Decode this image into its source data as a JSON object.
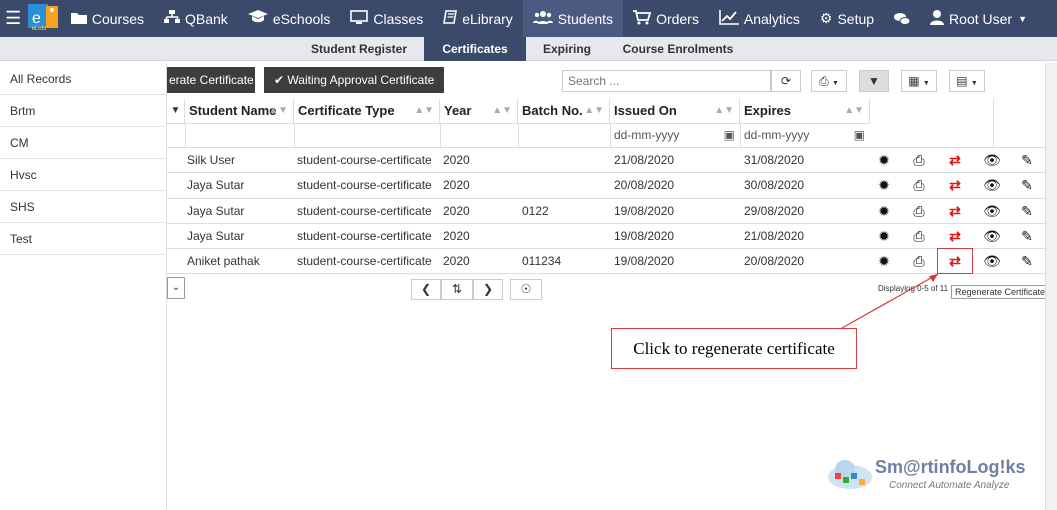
{
  "nav": {
    "logo_text": "eLuts",
    "items": [
      {
        "label": "Courses",
        "icon": "folder-icon"
      },
      {
        "label": "QBank",
        "icon": "sitemap-icon"
      },
      {
        "label": "eSchools",
        "icon": "graduation-cap-icon"
      },
      {
        "label": "Classes",
        "icon": "monitor-icon"
      },
      {
        "label": "eLibrary",
        "icon": "book-icon"
      },
      {
        "label": "Students",
        "icon": "users-icon"
      },
      {
        "label": "Orders",
        "icon": "cart-icon"
      },
      {
        "label": "Analytics",
        "icon": "chart-icon"
      }
    ],
    "setup": "Setup",
    "user": "Root User"
  },
  "subnav": [
    "Student Register",
    "Certificates",
    "Expiring",
    "Course Enrolments"
  ],
  "sidebar": [
    "All Records",
    "Brtm",
    "CM",
    "Hvsc",
    "SHS",
    "Test"
  ],
  "toolbar": {
    "generate": "erate Certificate",
    "waiting": "Waiting Approval Certificate",
    "search_placeholder": "Search ..."
  },
  "table": {
    "headers": [
      "Student Name",
      "Certificate Type",
      "Year",
      "Batch No.",
      "Issued On",
      "Expires"
    ],
    "date_placeholder": "dd-mm-yyyy",
    "rows": [
      {
        "name": "Silk User",
        "type": "student-course-certificate",
        "year": "2020",
        "batch": "",
        "issued": "21/08/2020",
        "expires": "31/08/2020"
      },
      {
        "name": "Jaya Sutar",
        "type": "student-course-certificate",
        "year": "2020",
        "batch": "",
        "issued": "20/08/2020",
        "expires": "30/08/2020"
      },
      {
        "name": "Jaya Sutar",
        "type": "student-course-certificate",
        "year": "2020",
        "batch": "0122",
        "issued": "19/08/2020",
        "expires": "29/08/2020"
      },
      {
        "name": "Jaya Sutar",
        "type": "student-course-certificate",
        "year": "2020",
        "batch": "",
        "issued": "19/08/2020",
        "expires": "21/08/2020"
      },
      {
        "name": "Aniket pathak",
        "type": "student-course-certificate",
        "year": "2020",
        "batch": "011234",
        "issued": "19/08/2020",
        "expires": "20/08/2020"
      }
    ]
  },
  "pager": {
    "display": "Displaying 0-5 of 11"
  },
  "tooltip": "Regenerate Certificate",
  "callout": "Click to regenerate certificate",
  "watermark": {
    "brand": "Sm@rtinfoLog!ks",
    "tagline": "Connect Automate Analyze"
  },
  "colors": {
    "nav_bg": "#3b4a6b",
    "annotation": "#d13b3b",
    "regen_icon": "#e0161b"
  }
}
